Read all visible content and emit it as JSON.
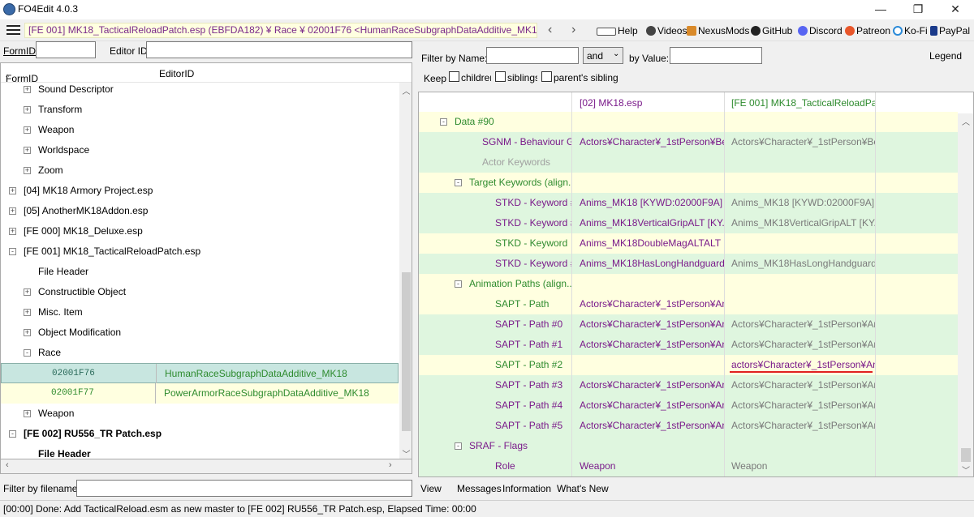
{
  "window": {
    "title": "FO4Edit 4.0.3",
    "minimize": "—",
    "maximize": "❐",
    "close": "✕"
  },
  "toolbar": {
    "record_path": "[FE 001] MK18_TacticalReloadPatch.esp (EBFDA182) ¥ Race ¥ 02001F76 <HumanRaceSubgraphDataAdditive_MK18>",
    "back": "‹",
    "forward": "›",
    "links": [
      "Help",
      "Videos",
      "NexusMods",
      "GitHub",
      "Discord",
      "Patreon",
      "Ko-Fi",
      "PayPal"
    ]
  },
  "left": {
    "formid_label": "FormID",
    "editorid_label": "Editor ID",
    "col_formid": "FormID",
    "col_editorid": "EditorID",
    "sort_arrow": "^",
    "filter_label": "Filter by filename:",
    "tree": [
      {
        "text": "Sound Descriptor",
        "expand": "+"
      },
      {
        "text": "Transform",
        "expand": "+"
      },
      {
        "text": "Weapon",
        "expand": "+"
      },
      {
        "text": "Worldspace",
        "expand": "+"
      },
      {
        "text": "Zoom",
        "expand": "+"
      },
      {
        "text": "[04] MK18 Armory Project.esp",
        "expand": "+"
      },
      {
        "text": "[05] AnotherMK18Addon.esp",
        "expand": "+"
      },
      {
        "text": "[FE 000] MK18_Deluxe.esp",
        "expand": "+"
      },
      {
        "text": "[FE 001] MK18_TacticalReloadPatch.esp",
        "expand": "-"
      },
      {
        "text": "File Header",
        "expand": ""
      },
      {
        "text": "Constructible Object",
        "expand": "+"
      },
      {
        "text": "Misc. Item",
        "expand": "+"
      },
      {
        "text": "Object Modification",
        "expand": "+"
      },
      {
        "text": "Race",
        "expand": "-"
      },
      {
        "formid": "02001F76",
        "editorid": "HumanRaceSubgraphDataAdditive_MK18"
      },
      {
        "formid": "02001F77",
        "editorid": "PowerArmorRaceSubgraphDataAdditive_MK18"
      },
      {
        "text": "Weapon",
        "expand": "+"
      },
      {
        "text": "[FE 002] RU556_TR Patch.esp",
        "expand": "-"
      },
      {
        "text": "File Header",
        "expand": ""
      }
    ]
  },
  "right": {
    "filter_name_label": "Filter by Name:",
    "and_value": "and",
    "by_value_label": "by Value:",
    "legend": "Legend",
    "keep_label": "Keep",
    "keep_options": [
      "children",
      "siblings",
      "parent's sibling"
    ],
    "col1_header": "[02] MK18.esp",
    "col2_header": "[FE 001] MK18_TacticalReloadPatch...",
    "rows": [
      {
        "label": "Data #90",
        "v1": "",
        "v2": ""
      },
      {
        "label": "SGNM - Behaviour Gra...",
        "v1": "Actors¥Character¥_1stPerson¥Be...",
        "v2": "Actors¥Character¥_1stPerson¥Be..."
      },
      {
        "label": "Actor Keywords",
        "v1": "",
        "v2": ""
      },
      {
        "label": "Target Keywords (align...",
        "v1": "",
        "v2": ""
      },
      {
        "label": "STKD - Keyword #0",
        "v1": "Anims_MK18 [KYWD:02000F9A]",
        "v2": "Anims_MK18 [KYWD:02000F9A]"
      },
      {
        "label": "STKD - Keyword #1",
        "v1": "Anims_MK18VerticalGripALT [KY...",
        "v2": "Anims_MK18VerticalGripALT [KY..."
      },
      {
        "label": "STKD - Keyword",
        "v1": "Anims_MK18DoubleMagALTALT [...",
        "v2": ""
      },
      {
        "label": "STKD - Keyword #2",
        "v1": "Anims_MK18HasLongHandguard...",
        "v2": "Anims_MK18HasLongHandguard..."
      },
      {
        "label": "Animation Paths (align...",
        "v1": "",
        "v2": ""
      },
      {
        "label": "SAPT - Path",
        "v1": "Actors¥Character¥_1stPerson¥Ani...",
        "v2": ""
      },
      {
        "label": "SAPT - Path #0",
        "v1": "Actors¥Character¥_1stPerson¥Ani...",
        "v2": "Actors¥Character¥_1stPerson¥Ani..."
      },
      {
        "label": "SAPT - Path #1",
        "v1": "Actors¥Character¥_1stPerson¥Ani...",
        "v2": "Actors¥Character¥_1stPerson¥Ani..."
      },
      {
        "label": "SAPT - Path #2",
        "v1": "",
        "v2": "actors¥Character¥_1stPerson¥Ani..."
      },
      {
        "label": "SAPT - Path #3",
        "v1": "Actors¥Character¥_1stPerson¥Ani...",
        "v2": "Actors¥Character¥_1stPerson¥Ani..."
      },
      {
        "label": "SAPT - Path #4",
        "v1": "Actors¥Character¥_1stPerson¥Ani...",
        "v2": "Actors¥Character¥_1stPerson¥Ani..."
      },
      {
        "label": "SAPT - Path #5",
        "v1": "Actors¥Character¥_1stPerson¥Ani...",
        "v2": "Actors¥Character¥_1stPerson¥Ani..."
      },
      {
        "label": "SRAF - Flags",
        "v1": "",
        "v2": ""
      },
      {
        "label": "Role",
        "v1": "Weapon",
        "v2": "Weapon"
      }
    ],
    "tabs": [
      "View",
      "Messages",
      "Information",
      "What's New"
    ]
  },
  "status": "[00:00] Done: Add TacticalReload.esm as new master to [FE 002] RU556_TR Patch.esp, Elapsed Time: 00:00"
}
